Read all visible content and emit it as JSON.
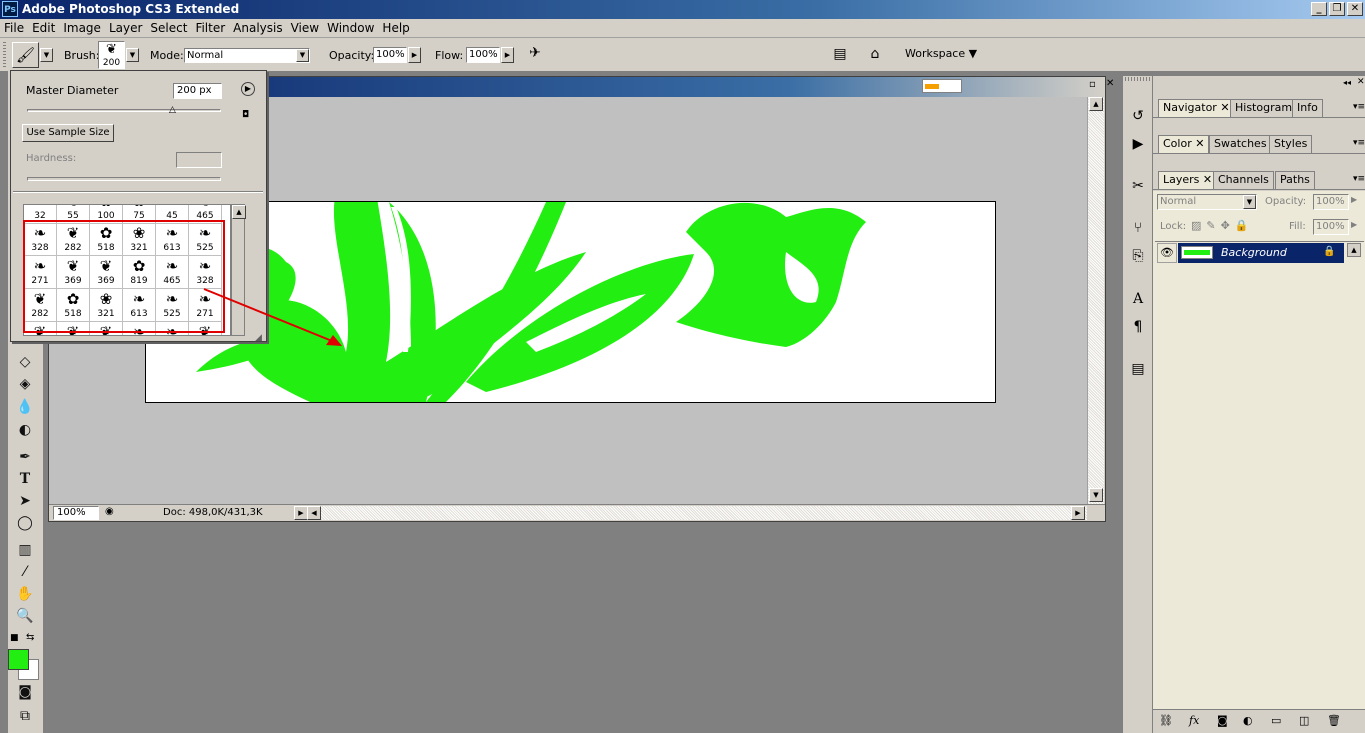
{
  "app": {
    "title": "Adobe Photoshop CS3 Extended",
    "logo": "Ps",
    "window_buttons": [
      "_",
      "❐",
      "✕"
    ]
  },
  "menu": [
    "File",
    "Edit",
    "Image",
    "Layer",
    "Select",
    "Filter",
    "Analysis",
    "View",
    "Window",
    "Help"
  ],
  "options_bar": {
    "brush_label": "Brush:",
    "brush_size": "200",
    "mode_label": "Mode:",
    "mode_value": "Normal",
    "opacity_label": "Opacity:",
    "opacity_value": "100%",
    "flow_label": "Flow:",
    "flow_value": "100%",
    "workspace_label": "Workspace ▼"
  },
  "brush_picker": {
    "master_diameter_label": "Master Diameter",
    "master_diameter_value": "200 px",
    "use_sample_size_label": "Use Sample Size",
    "hardness_label": "Hardness:",
    "rows": [
      [
        "32",
        "55",
        "100",
        "75",
        "45",
        "465"
      ],
      [
        "328",
        "282",
        "518",
        "321",
        "613",
        "525"
      ],
      [
        "271",
        "369",
        "369",
        "819",
        "465",
        "328"
      ],
      [
        "282",
        "518",
        "321",
        "613",
        "525",
        "271"
      ],
      [
        "",
        "",
        "",
        "",
        "",
        ""
      ]
    ]
  },
  "document": {
    "zoom": "100%",
    "doc_info": "Doc: 498,0K/431,3K"
  },
  "panels": {
    "group1_tabs": [
      "Navigator",
      "Histogram",
      "Info"
    ],
    "group2_tabs": [
      "Color",
      "Swatches",
      "Styles"
    ],
    "group3_tabs": [
      "Layers",
      "Channels",
      "Paths"
    ],
    "layers": {
      "blend_mode": "Normal",
      "opacity_label": "Opacity:",
      "opacity_value": "100%",
      "lock_label": "Lock:",
      "fill_label": "Fill:",
      "fill_value": "100%",
      "layer_name": "Background"
    }
  },
  "colors": {
    "foreground": "#22ee11",
    "background": "#ffffff",
    "artwork": "#22ee11",
    "layer_selected": "#0a246a",
    "annotation": "#e00000"
  }
}
